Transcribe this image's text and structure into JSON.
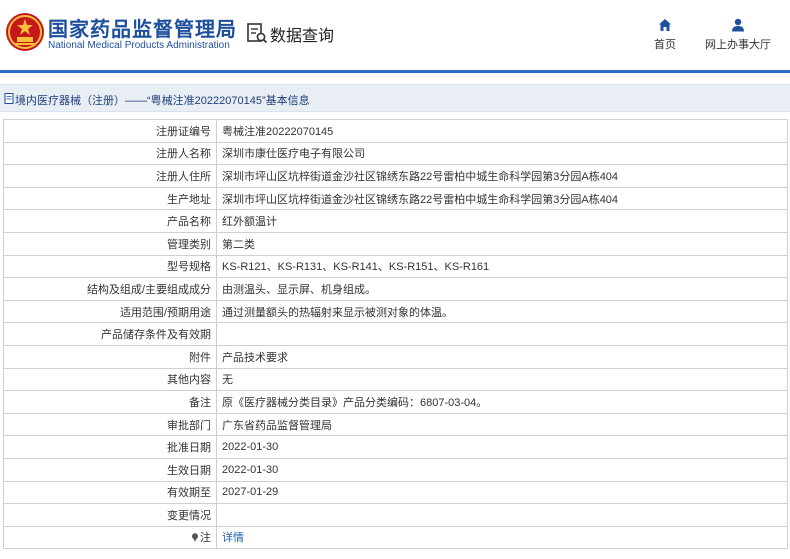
{
  "header": {
    "brand_cn": "国家药品监督管理局",
    "brand_en": "National Medical Products Administration",
    "search_title": "数据查询",
    "nav": [
      {
        "label": "首页",
        "icon": "home-icon"
      },
      {
        "label": "网上办事大厅",
        "icon": "user-icon"
      }
    ],
    "accent_color": "#2b6cc4"
  },
  "breadcrumb": {
    "text": "境内医疗器械（注册）——“粤械注准20222070145”基本信息"
  },
  "details": {
    "rows": [
      {
        "label": "注册证编号",
        "value": "粤械注准20222070145"
      },
      {
        "label": "注册人名称",
        "value": "深圳市康仕医疗电子有限公司"
      },
      {
        "label": "注册人住所",
        "value": "深圳市坪山区坑梓街道金沙社区锦绣东路22号雷柏中城生命科学园第3分园A栋404"
      },
      {
        "label": "生产地址",
        "value": "深圳市坪山区坑梓街道金沙社区锦绣东路22号雷柏中城生命科学园第3分园A栋404"
      },
      {
        "label": "产品名称",
        "value": "红外额温计"
      },
      {
        "label": "管理类别",
        "value": "第二类"
      },
      {
        "label": "型号规格",
        "value": "KS-R121、KS-R131、KS-R141、KS-R151、KS-R161"
      },
      {
        "label": "结构及组成/主要组成成分",
        "value": "由测温头、显示屏、机身组成。"
      },
      {
        "label": "适用范围/预期用途",
        "value": "通过测量额头的热辐射来显示被测对象的体温。"
      },
      {
        "label": "产品储存条件及有效期",
        "value": ""
      },
      {
        "label": "附件",
        "value": "产品技术要求"
      },
      {
        "label": "其他内容",
        "value": "无"
      },
      {
        "label": "备注",
        "value": "原《医疗器械分类目录》产品分类编码：6807-03-04。"
      },
      {
        "label": "审批部门",
        "value": "广东省药品监督管理局"
      },
      {
        "label": "批准日期",
        "value": "2022-01-30"
      },
      {
        "label": "生效日期",
        "value": "2022-01-30"
      },
      {
        "label": "有效期至",
        "value": "2027-01-29"
      },
      {
        "label": "变更情况",
        "value": ""
      }
    ],
    "note_label": "注",
    "note_link": "详情"
  }
}
